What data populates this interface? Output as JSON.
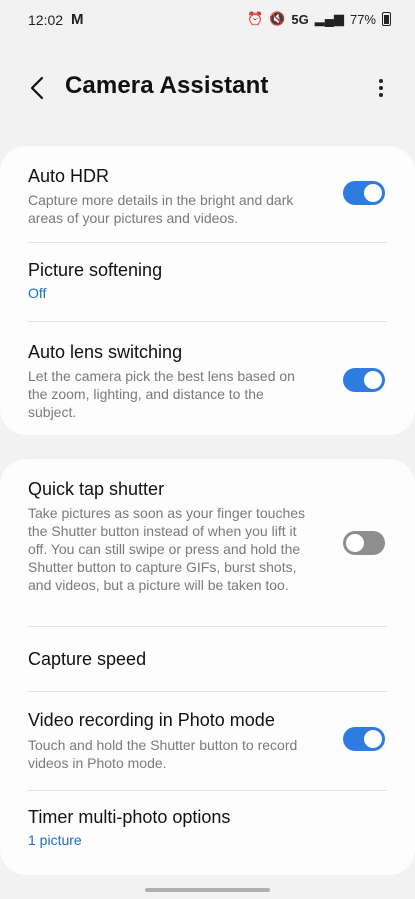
{
  "status_bar": {
    "time": "12:02",
    "signal_label": "5G",
    "battery": "77%"
  },
  "header": {
    "title": "Camera Assistant"
  },
  "settings": {
    "auto_hdr": {
      "label": "Auto HDR",
      "desc": "Capture more details in the bright and dark areas of your pictures and videos.",
      "enabled": true
    },
    "picture_softening": {
      "label": "Picture softening",
      "value": "Off"
    },
    "auto_lens": {
      "label": "Auto lens switching",
      "desc": "Let the camera pick the best lens based on the zoom, lighting, and distance to the subject.",
      "enabled": true
    },
    "quick_tap": {
      "label": "Quick tap shutter",
      "desc": "Take pictures as soon as your finger touches the Shutter button instead of when you lift it off. You can still swipe or press and hold the Shutter button to capture GIFs, burst shots, and videos, but a picture will be taken too.",
      "enabled": false
    },
    "capture_speed": {
      "label": "Capture speed"
    },
    "video_photo_mode": {
      "label": "Video recording in Photo mode",
      "desc": "Touch and hold the Shutter button to record videos in Photo mode.",
      "enabled": true
    },
    "timer_multi": {
      "label": "Timer multi-photo options",
      "value": "1 picture"
    }
  },
  "colors": {
    "accent": "#2f7ce0",
    "value_text": "#1a6fc4",
    "toggle_off": "#8e8e8e"
  }
}
